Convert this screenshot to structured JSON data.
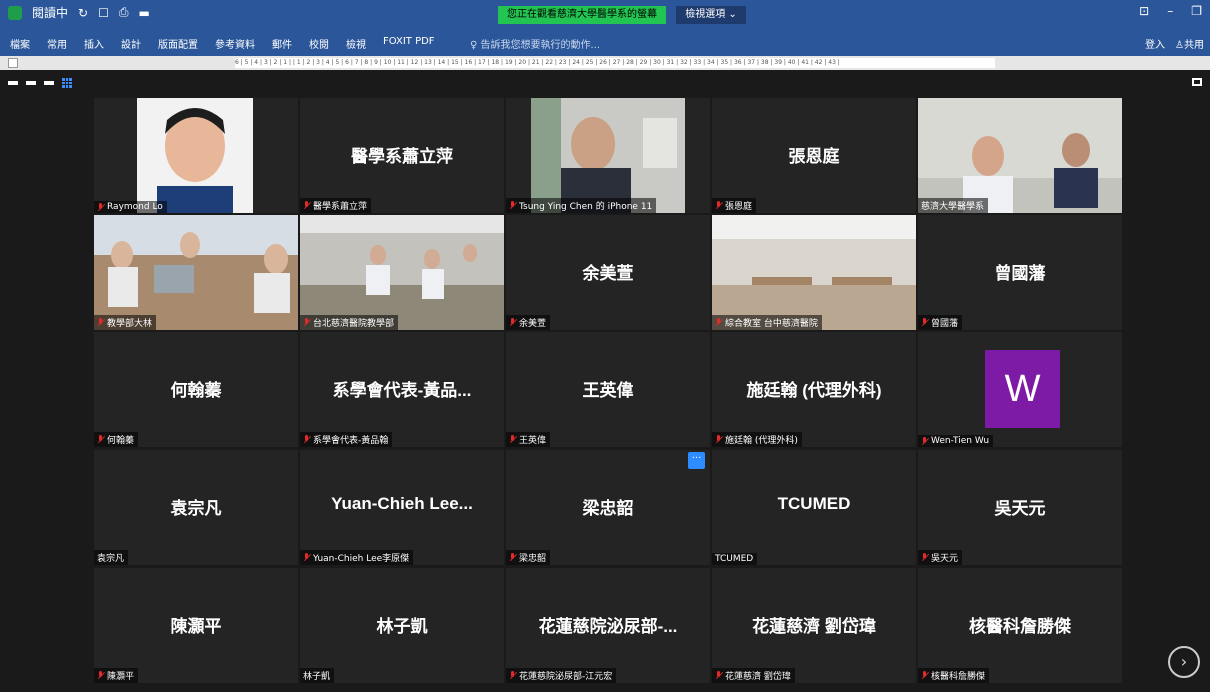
{
  "word": {
    "qa_mode": "閱讀中",
    "share_banner": "您正在觀看慈濟大學醫學系的螢幕",
    "view_options": "檢視選項 ⌄",
    "tabs": [
      "檔案",
      "常用",
      "插入",
      "設計",
      "版面配置",
      "參考資料",
      "郵件",
      "校閱",
      "檢視",
      "FOXIT PDF"
    ],
    "tell_me": "告訴我您想要執行的動作...",
    "sign_in": "登入",
    "share": "共用",
    "ruler_marks": "6 | 5 | 4 | 3 | 2 | 1 |   | 1 | 2 | 3 | 4 | 5 | 6 | 7 | 8 | 9 | 10 | 11 | 12 | 13 | 14 | 15 | 16 | 17 | 18 | 19 | 20 | 21 | 22 | 23 | 24 | 25 | 26 | 27 | 28 | 29 | 30 | 31 | 32 | 33 | 34 | 35 | 36 | 37 | 38 | 39 | 40 | 41 | 42 | 43 |"
  },
  "participants": [
    {
      "big": "",
      "label": "Raymond Lo",
      "muted": true
    },
    {
      "big": "醫學系蕭立萍",
      "label": "醫學系蕭立萍",
      "muted": true
    },
    {
      "big": "",
      "label": "Tsung Ying Chen 的 iPhone 11",
      "muted": true
    },
    {
      "big": "張恩庭",
      "label": "張恩庭",
      "muted": true
    },
    {
      "big": "",
      "label": "慈濟大學醫學系",
      "muted": false
    },
    {
      "big": "",
      "label": "教學部大林",
      "muted": true
    },
    {
      "big": "",
      "label": "台北慈濟醫院教學部",
      "muted": true
    },
    {
      "big": "余美萱",
      "label": "余美萱",
      "muted": true
    },
    {
      "big": "",
      "label": "綜合教室 台中慈濟醫院",
      "muted": true
    },
    {
      "big": "曾國藩",
      "label": "曾國藩",
      "muted": true
    },
    {
      "big": "何翰蓁",
      "label": "何翰蓁",
      "muted": true
    },
    {
      "big": "系學會代表-黃品...",
      "label": "系學會代表-黃品翰",
      "muted": true
    },
    {
      "big": "王英偉",
      "label": "王英偉",
      "muted": true
    },
    {
      "big": "施廷翰 (代理外科)",
      "label": "施廷翰 (代理外科)",
      "muted": true
    },
    {
      "big": "",
      "label": "Wen-Tien Wu",
      "muted": true,
      "avatar": "W"
    },
    {
      "big": "袁宗凡",
      "label": "袁宗凡",
      "muted": false
    },
    {
      "big": "Yuan-Chieh  Lee...",
      "label": "Yuan-Chieh Lee李原傑",
      "muted": true
    },
    {
      "big": "梁忠韶",
      "label": "梁忠韶",
      "muted": true
    },
    {
      "big": "TCUMED",
      "label": "TCUMED",
      "muted": false
    },
    {
      "big": "吳天元",
      "label": "吳天元",
      "muted": true
    },
    {
      "big": "陳灝平",
      "label": "陳灝平",
      "muted": true
    },
    {
      "big": "林子凱",
      "label": "林子凱",
      "muted": false
    },
    {
      "big": "花蓮慈院泌尿部-...",
      "label": "花蓮慈院泌尿部-江元宏",
      "muted": true
    },
    {
      "big": "花蓮慈濟 劉岱瑋",
      "label": "花蓮慈濟 劉岱瑋",
      "muted": true
    },
    {
      "big": "核醫科詹勝傑",
      "label": "核醫科詹勝傑",
      "muted": true
    }
  ],
  "controls": {
    "more": "···",
    "next": "›"
  },
  "colors": {
    "ribbon": "#2b579a",
    "banner": "#23c552",
    "active_speaker": "#e8e34b",
    "avatar_w": "#7d1aa6"
  }
}
